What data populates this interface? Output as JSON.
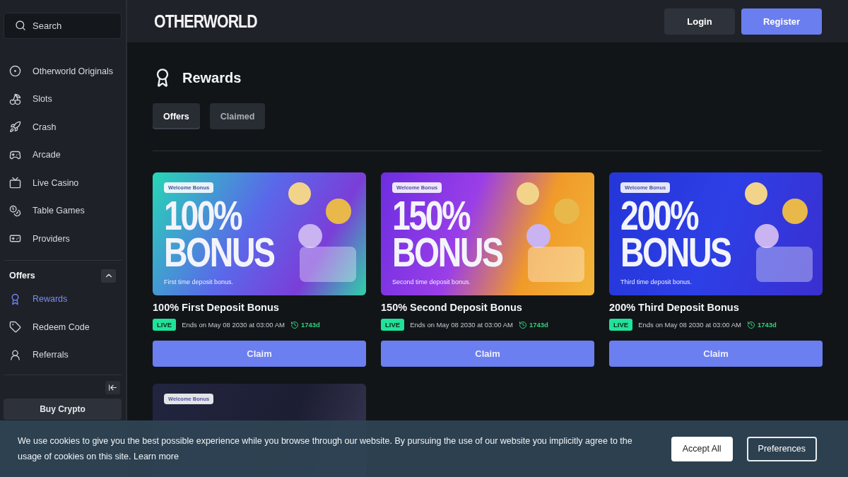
{
  "search": {
    "placeholder": "Search"
  },
  "nav": [
    {
      "label": "Otherworld Originals",
      "selected": false
    },
    {
      "label": "Slots",
      "selected": false
    },
    {
      "label": "Crash",
      "selected": false
    },
    {
      "label": "Arcade",
      "selected": false
    },
    {
      "label": "Live Casino",
      "selected": false
    },
    {
      "label": "Table Games",
      "selected": false
    },
    {
      "label": "Providers",
      "selected": false
    }
  ],
  "offers_section": {
    "title": "Offers",
    "expanded": true,
    "items": [
      {
        "label": "Rewards",
        "selected": true
      },
      {
        "label": "Redeem Code",
        "selected": false
      },
      {
        "label": "Referrals",
        "selected": false
      }
    ]
  },
  "buy_crypto": "Buy Crypto",
  "header": {
    "logo": "OTHERWORLD",
    "buttons": [
      {
        "label": "Login",
        "kind": "secondary"
      },
      {
        "label": "Register",
        "kind": "primary"
      }
    ]
  },
  "page": {
    "title": "Rewards",
    "tabs": [
      {
        "label": "Offers",
        "selected": true
      },
      {
        "label": "Claimed",
        "selected": false
      }
    ]
  },
  "offers": [
    {
      "banner": {
        "badge": "Welcome Bonus",
        "headline": "100%",
        "headline_2": "BONUS",
        "caption": "First time deposit bonus."
      },
      "title": "100% First Deposit Bonus",
      "status": "LIVE",
      "ends": "Ends on May 08 2030 at 03:00 AM",
      "remaining": "1743d",
      "button": "Claim"
    },
    {
      "banner": {
        "badge": "Welcome Bonus",
        "headline": "150%",
        "headline_2": "BONUS",
        "caption": "Second time deposit bonus."
      },
      "title": "150% Second Deposit Bonus",
      "status": "LIVE",
      "ends": "Ends on May 08 2030 at 03:00 AM",
      "remaining": "1743d",
      "button": "Claim"
    },
    {
      "banner": {
        "badge": "Welcome Bonus",
        "headline": "200%",
        "headline_2": "BONUS",
        "caption": "Third time deposit bonus."
      },
      "title": "200% Third Deposit Bonus",
      "status": "LIVE",
      "ends": "Ends on May 08 2030 at 03:00 AM",
      "remaining": "1743d",
      "button": "Claim"
    },
    {
      "banner": {
        "badge": "Welcome Bonus"
      }
    }
  ],
  "cookie": {
    "text": "We use cookies to give you the best possible experience while you browse through our website. By pursuing the use of our website you implicitly agree to the usage of cookies on this site.",
    "link": "Learn more",
    "buttons": [
      {
        "label": "Accept All",
        "kind": "solid"
      },
      {
        "label": "Preferences",
        "kind": "outline"
      }
    ]
  }
}
